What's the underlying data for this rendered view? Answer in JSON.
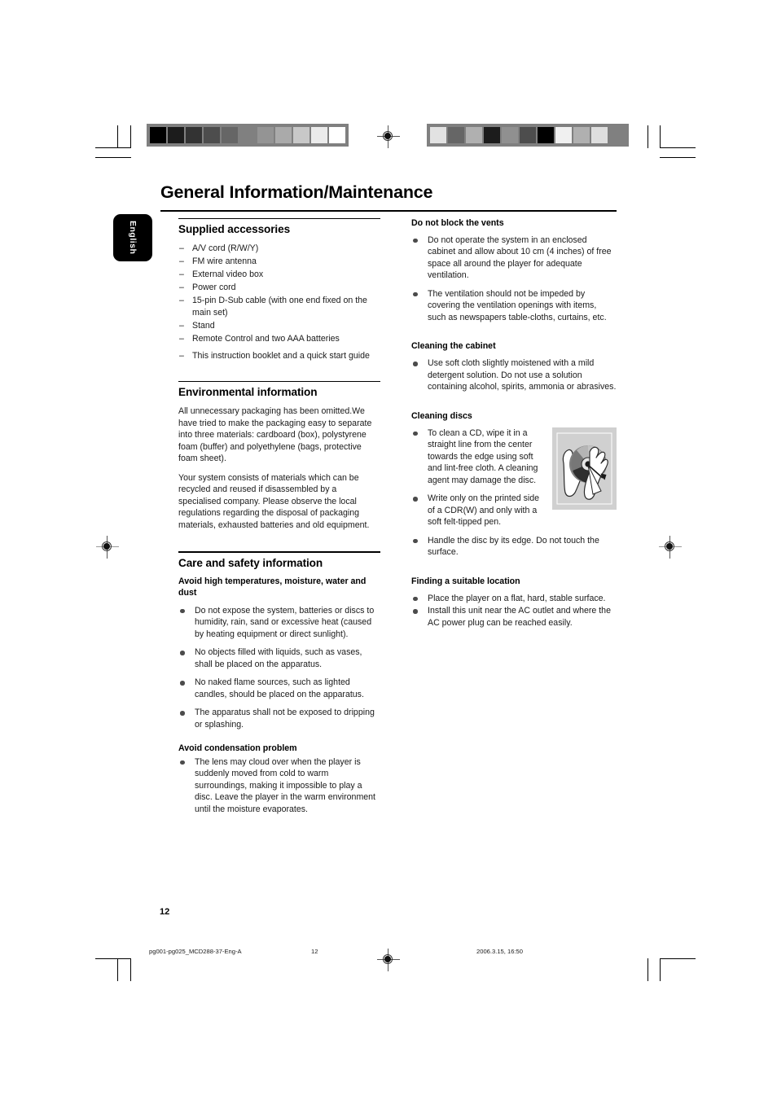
{
  "document": {
    "title": "General Information/Maintenance",
    "language_tab": "English",
    "page_number": "12"
  },
  "colorbars": {
    "left_swatches": [
      "#000000",
      "#1c1c1c",
      "#333333",
      "#4d4d4d",
      "#666666",
      "#808080",
      "#949494",
      "#aaaaaa",
      "#c8c8c8",
      "#ebebeb",
      "#ffffff"
    ],
    "right_swatches": [
      "#e2e2e2",
      "#666666",
      "#b0b0b0",
      "#1c1c1c",
      "#909090",
      "#4d4d4d",
      "#000000",
      "#f0f0f0",
      "#b0b0b0",
      "#dedede",
      "#808080"
    ]
  },
  "left_column": {
    "supplied_accessories": {
      "heading": "Supplied accessories",
      "items": [
        "A/V cord (R/W/Y)",
        "FM wire antenna",
        "External video box",
        "Power cord",
        "15-pin D-Sub cable (with one end fixed on the main set)",
        "Stand",
        "Remote Control and two AAA batteries",
        "This instruction booklet and a quick start guide"
      ]
    },
    "environmental_information": {
      "heading": "Environmental information",
      "paragraphs": [
        "All unnecessary packaging has been omitted.We have tried to make the packaging easy to separate into three materials: cardboard (box), polystyrene foam (buffer) and polyethylene (bags, protective foam sheet).",
        "Your system consists of materials which can be recycled and reused if disassembled by a specialised company. Please observe the local regulations regarding the disposal of packaging materials, exhausted batteries and old equipment."
      ]
    },
    "care_and_safety": {
      "heading": "Care and safety information",
      "subsections": [
        {
          "subheading": "Avoid high temperatures, moisture, water and dust",
          "bullets": [
            "Do not expose the system, batteries or discs to humidity, rain, sand or excessive heat (caused by heating equipment or direct sunlight).",
            "No objects filled with liquids, such as vases, shall be placed on the apparatus.",
            "No naked flame sources, such as lighted candles, should be placed on the apparatus.",
            "The apparatus shall not be exposed to dripping or splashing."
          ]
        },
        {
          "subheading": "Avoid condensation problem",
          "bullets": [
            "The lens may cloud over when the player is suddenly moved from cold to warm surroundings, making it impossible to play a disc. Leave the player in the warm environment until the moisture evaporates."
          ]
        }
      ]
    }
  },
  "right_column": {
    "do_not_block_vents": {
      "subheading": "Do not block the vents",
      "bullets": [
        "Do not operate the system in an enclosed cabinet and allow about 10 cm (4 inches) of free space all around the player for adequate ventilation.",
        "The ventilation should not be impeded by covering the ventilation openings with items, such as newspapers table-cloths, curtains, etc."
      ]
    },
    "cleaning_the_cabinet": {
      "subheading": "Cleaning the cabinet",
      "bullets": [
        "Use soft cloth slightly moistened with a mild detergent solution. Do not use a solution containing alcohol, spirits, ammonia or abrasives."
      ]
    },
    "cleaning_discs": {
      "subheading": "Cleaning discs",
      "bullets": [
        "To clean a CD, wipe it in a straight line from the center towards the edge using soft and lint-free cloth. A cleaning agent may damage the disc.",
        "Write only on the printed side of a CDR(W) and only with a soft felt-tipped pen.",
        "Handle the disc by its edge. Do not touch the surface."
      ],
      "figure_caption": "hands-wiping-cd-illustration"
    },
    "finding_a_suitable_location": {
      "subheading": "Finding a suitable location",
      "bullets": [
        "Place the player on a flat, hard, stable surface.",
        "Install this unit near the AC outlet and where the AC power plug can be reached easily."
      ]
    }
  },
  "footer": {
    "file_name": "pg001-pg025_MCD288-37-Eng-A",
    "page": "12",
    "timestamp": "2006.3.15, 16:50"
  }
}
